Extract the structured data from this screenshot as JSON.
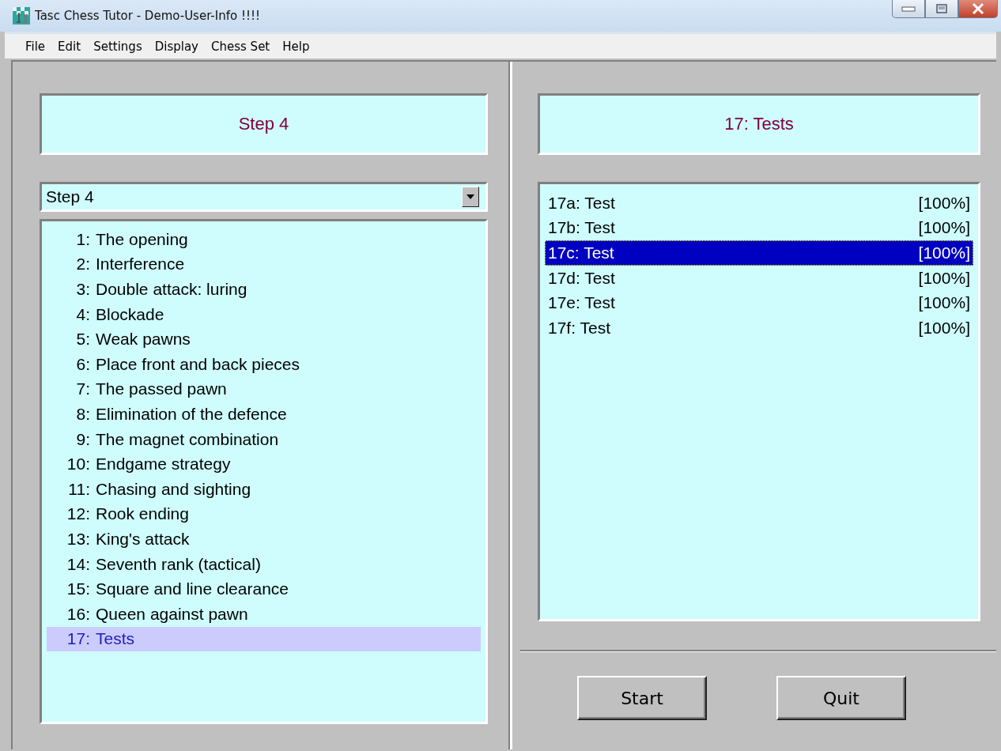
{
  "window": {
    "title": "Tasc Chess Tutor - Demo-User-Info !!!!"
  },
  "menu": [
    "File",
    "Edit",
    "Settings",
    "Display",
    "Chess Set",
    "Help"
  ],
  "left": {
    "header": "Step 4",
    "dropdown": {
      "value": "Step 4"
    },
    "lessons": [
      {
        "number": "1:",
        "title": "The opening",
        "selected": false
      },
      {
        "number": "2:",
        "title": "Interference",
        "selected": false
      },
      {
        "number": "3:",
        "title": "Double attack: luring",
        "selected": false
      },
      {
        "number": "4:",
        "title": "Blockade",
        "selected": false
      },
      {
        "number": "5:",
        "title": "Weak pawns",
        "selected": false
      },
      {
        "number": "6:",
        "title": "Place front and back pieces",
        "selected": false
      },
      {
        "number": "7:",
        "title": "The passed pawn",
        "selected": false
      },
      {
        "number": "8:",
        "title": "Elimination of the defence",
        "selected": false
      },
      {
        "number": "9:",
        "title": "The magnet combination",
        "selected": false
      },
      {
        "number": "10:",
        "title": "Endgame strategy",
        "selected": false
      },
      {
        "number": "11:",
        "title": "Chasing and sighting",
        "selected": false
      },
      {
        "number": "12:",
        "title": "Rook ending",
        "selected": false
      },
      {
        "number": "13:",
        "title": "King's attack",
        "selected": false
      },
      {
        "number": "14:",
        "title": "Seventh rank (tactical)",
        "selected": false
      },
      {
        "number": "15:",
        "title": "Square and line clearance",
        "selected": false
      },
      {
        "number": "16:",
        "title": "Queen against pawn",
        "selected": false
      },
      {
        "number": "17:",
        "title": "Tests",
        "selected": true
      }
    ]
  },
  "right": {
    "header": "17: Tests",
    "tests": [
      {
        "label": "17a: Test",
        "score": "[100%]",
        "selected": false
      },
      {
        "label": "17b: Test",
        "score": "[100%]",
        "selected": false
      },
      {
        "label": "17c: Test",
        "score": "[100%]",
        "selected": true
      },
      {
        "label": "17d: Test",
        "score": "[100%]",
        "selected": false
      },
      {
        "label": "17e: Test",
        "score": "[100%]",
        "selected": false
      },
      {
        "label": "17f: Test",
        "score": "[100%]",
        "selected": false
      }
    ],
    "buttons": [
      "Start",
      "Quit"
    ]
  }
}
